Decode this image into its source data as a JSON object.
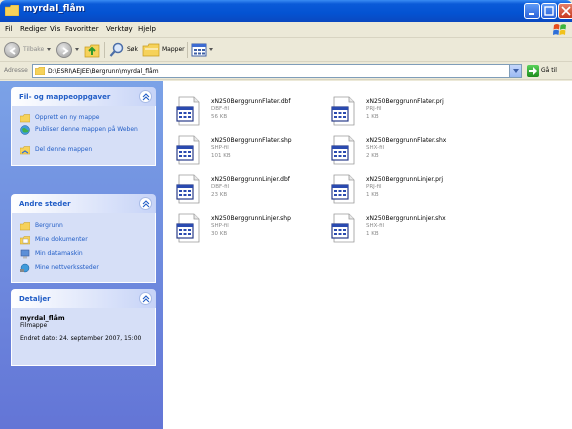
{
  "window": {
    "title": "myrdal_flåm"
  },
  "menu": [
    "Fil",
    "Rediger",
    "Vis",
    "Favoritter",
    "Verktøy",
    "Hjelp"
  ],
  "toolbar": {
    "back_label": "Tilbake",
    "search_label": "Søk",
    "folders_label": "Mapper"
  },
  "address": {
    "label": "Adresse",
    "path": "D:\\ESRI\\AEJEE\\Bergrunn\\myrdal_flåm",
    "go_label": "Gå til"
  },
  "panels": {
    "tasks": {
      "title": "Fil- og mappeoppgaver",
      "items": [
        {
          "label": "Opprett en ny mappe",
          "icon": "new-folder-icon"
        },
        {
          "label": "Publiser denne mappen på Weben",
          "icon": "web-publish-icon"
        },
        {
          "label": "Del denne mappen",
          "icon": "share-folder-icon"
        }
      ]
    },
    "places": {
      "title": "Andre steder",
      "items": [
        {
          "label": "Bergrunn",
          "icon": "folder-icon"
        },
        {
          "label": "Mine dokumenter",
          "icon": "documents-icon"
        },
        {
          "label": "Min datamaskin",
          "icon": "computer-icon"
        },
        {
          "label": "Mine nettverkssteder",
          "icon": "network-icon"
        }
      ]
    },
    "details": {
      "title": "Detaljer",
      "name": "myrdal_flåm",
      "type": "Filmappe",
      "date": "Endret dato: 24. september 2007, 15:00"
    }
  },
  "files": [
    {
      "name": "xN250BerggrunnFlater.dbf",
      "type": "DBF-fil",
      "size": "56 KB"
    },
    {
      "name": "xN250BerggrunnFlater.prj",
      "type": "PRJ-fil",
      "size": "1 KB"
    },
    {
      "name": "xN250BerggrunnFlater.shp",
      "type": "SHP-fil",
      "size": "101 KB"
    },
    {
      "name": "xN250BerggrunnFlater.shx",
      "type": "SHX-fil",
      "size": "2 KB"
    },
    {
      "name": "xN250BerggrunnLinjer.dbf",
      "type": "DBF-fil",
      "size": "23 KB"
    },
    {
      "name": "xN250BerggrunnLinjer.prj",
      "type": "PRJ-fil",
      "size": "1 KB"
    },
    {
      "name": "xN250BerggrunnLinjer.shp",
      "type": "SHP-fil",
      "size": "30 KB"
    },
    {
      "name": "xN250BerggrunnLinjer.shx",
      "type": "SHX-fil",
      "size": "1 KB"
    }
  ],
  "colors": {
    "titlebar": "#0453d2",
    "taskpane": "#6f8fe0",
    "panel_title": "#215dc6",
    "link": "#215dc6"
  }
}
